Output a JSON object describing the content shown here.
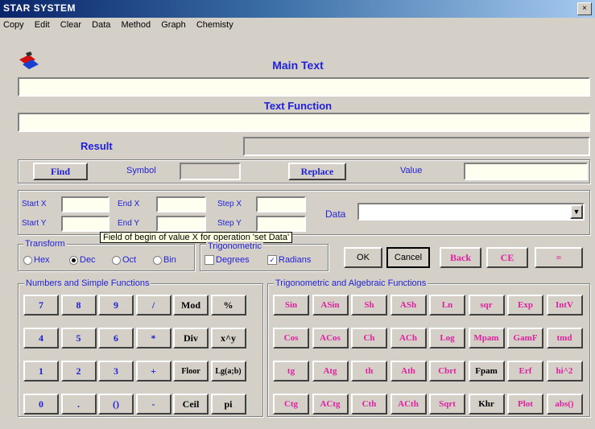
{
  "window": {
    "title": "STAR SYSTEM",
    "close_glyph": "×"
  },
  "menu": [
    "Copy",
    "Edit",
    "Clear",
    "Data",
    "Method",
    "Graph",
    "Chemisty"
  ],
  "main_text": {
    "heading": "Main Text",
    "value": ""
  },
  "text_function": {
    "heading": "Text Function",
    "value": ""
  },
  "result": {
    "label": "Result",
    "value": ""
  },
  "find_row": {
    "find_label": "Find",
    "symbol_label": "Symbol",
    "replace_label": "Replace",
    "value_label": "Value"
  },
  "range": {
    "start_x": "Start X",
    "end_x": "End X",
    "step_x": "Step X",
    "start_y": "Start Y",
    "end_y": "End Y",
    "step_y": "Step Y",
    "data_label": "Data"
  },
  "tooltip": "Field of begin of value X for operation 'set Data'",
  "transform": {
    "title": "Transform",
    "options": [
      "Hex",
      "Dec",
      "Oct",
      "Bin"
    ],
    "selected": "Dec"
  },
  "trig": {
    "title": "Trigonometric",
    "options": [
      "Degrees",
      "Radians"
    ],
    "checked": "Radians"
  },
  "action_buttons": {
    "ok": "OK",
    "cancel": "Cancel",
    "back": "Back",
    "ce": "CE",
    "equals": "="
  },
  "numbers": {
    "title": "Numbers and Simple Functions",
    "buttons": [
      [
        "7",
        "8",
        "9",
        "/",
        "Mod",
        "%"
      ],
      [
        "4",
        "5",
        "6",
        "*",
        "Div",
        "x^y"
      ],
      [
        "1",
        "2",
        "3",
        "+",
        "Floor",
        "Lg(a;b)"
      ],
      [
        "0",
        ".",
        "()",
        "-",
        "Ceil",
        "pi"
      ]
    ]
  },
  "trig_funcs": {
    "title": "Trigonometric and Algebraic Functions",
    "buttons": [
      [
        "Sin",
        "ASin",
        "Sh",
        "ASh",
        "Ln",
        "sqr",
        "Exp",
        "IntV"
      ],
      [
        "Cos",
        "ACos",
        "Ch",
        "ACh",
        "Log",
        "Mpam",
        "GamF",
        "tmd"
      ],
      [
        "tg",
        "Atg",
        "th",
        "Ath",
        "Cbrt",
        "Fpam",
        "Erf",
        "hi^2"
      ],
      [
        "Ctg",
        "ACtg",
        "Cth",
        "ACth",
        "Sqrt",
        "Khr",
        "Plot",
        "abs()"
      ]
    ]
  },
  "colors": {
    "accent": "#1f1fd8",
    "function": "#e020a0",
    "field": "#fffff0",
    "face": "#d4d0c8"
  },
  "icons": {
    "app": "app-logo-icon"
  }
}
